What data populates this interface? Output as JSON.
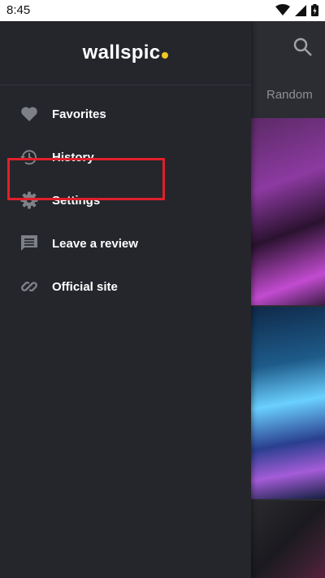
{
  "status_bar": {
    "time": "8:45"
  },
  "drawer": {
    "logo": "wallspic",
    "items": [
      {
        "label": "Favorites",
        "icon": "heart-icon"
      },
      {
        "label": "History",
        "icon": "history-icon"
      },
      {
        "label": "Settings",
        "icon": "gear-icon"
      },
      {
        "label": "Leave a review",
        "icon": "comment-icon"
      },
      {
        "label": "Official site",
        "icon": "link-icon"
      }
    ]
  },
  "main": {
    "tab": "Random",
    "search_icon": "search-icon"
  },
  "colors": {
    "accent_dot": "#f3c623",
    "highlight": "#e0202a"
  }
}
